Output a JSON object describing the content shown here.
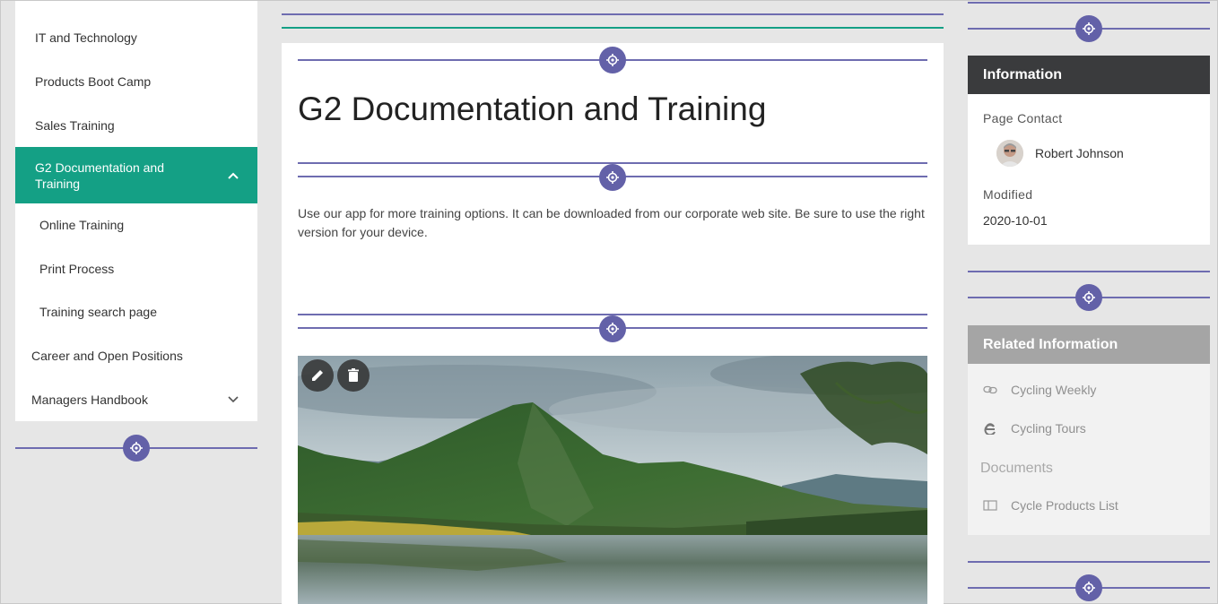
{
  "nav": {
    "items": [
      {
        "label": "IT and Technology"
      },
      {
        "label": "Products Boot Camp"
      },
      {
        "label": "Sales Training"
      },
      {
        "label": "G2 Documentation and Training"
      },
      {
        "label": "Online Training"
      },
      {
        "label": "Print Process"
      },
      {
        "label": "Training search page"
      },
      {
        "label": "Career and Open Positions"
      },
      {
        "label": "Managers Handbook"
      }
    ]
  },
  "main": {
    "title": "G2 Documentation and Training",
    "body": "Use our app for more training options. It can be downloaded from our corporate web site. Be sure to use the right version for your device."
  },
  "info": {
    "header": "Information",
    "contact_label": "Page Contact",
    "contact_name": "Robert Johnson",
    "modified_label": "Modified",
    "modified_value": "2020-10-01"
  },
  "related": {
    "header": "Related Information",
    "links": [
      {
        "label": "Cycling Weekly",
        "icon": "link-icon"
      },
      {
        "label": "Cycling Tours",
        "icon": "edge-icon"
      }
    ],
    "documents_label": "Documents",
    "documents": [
      {
        "label": "Cycle Products List",
        "icon": "document-icon"
      }
    ]
  },
  "colors": {
    "accent": "#14a085",
    "dropzone": "#6361a8",
    "info_header": "#3a3b3d",
    "related_header": "#a5a5a5"
  }
}
